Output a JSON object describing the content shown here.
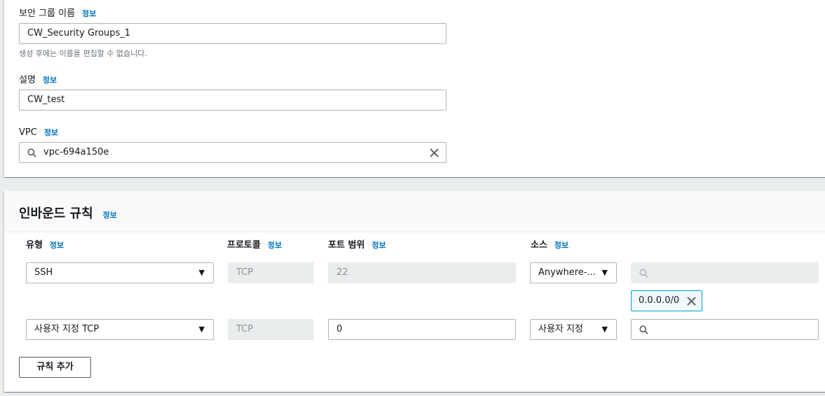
{
  "basic": {
    "sg_name_label": "보안 그룹 이름",
    "sg_name_info": "정보",
    "sg_name_value": "CW_Security Groups_1",
    "sg_name_hint": "생성 후에는 이름을 편집할 수 없습니다.",
    "desc_label": "설명",
    "desc_info": "정보",
    "desc_value": "CW_test",
    "vpc_label": "VPC",
    "vpc_info": "정보",
    "vpc_value": "vpc-694a150e"
  },
  "inbound": {
    "title": "인바운드 규칙",
    "info": "정보",
    "columns": {
      "type": "유형",
      "type_info": "정보",
      "protocol": "프로토콜",
      "protocol_info": "정보",
      "port": "포트 범위",
      "port_info": "정보",
      "source": "소스",
      "source_info": "정보"
    },
    "rules": [
      {
        "type": "SSH",
        "protocol": "TCP",
        "port": "22",
        "source": "Anywhere-...",
        "source_search": "",
        "cidr_chip": "0.0.0.0/0"
      },
      {
        "type": "사용자 지정 TCP",
        "protocol": "TCP",
        "port": "0",
        "source": "사용자 지정",
        "source_search": ""
      }
    ],
    "add_rule_button": "규칙 추가"
  }
}
